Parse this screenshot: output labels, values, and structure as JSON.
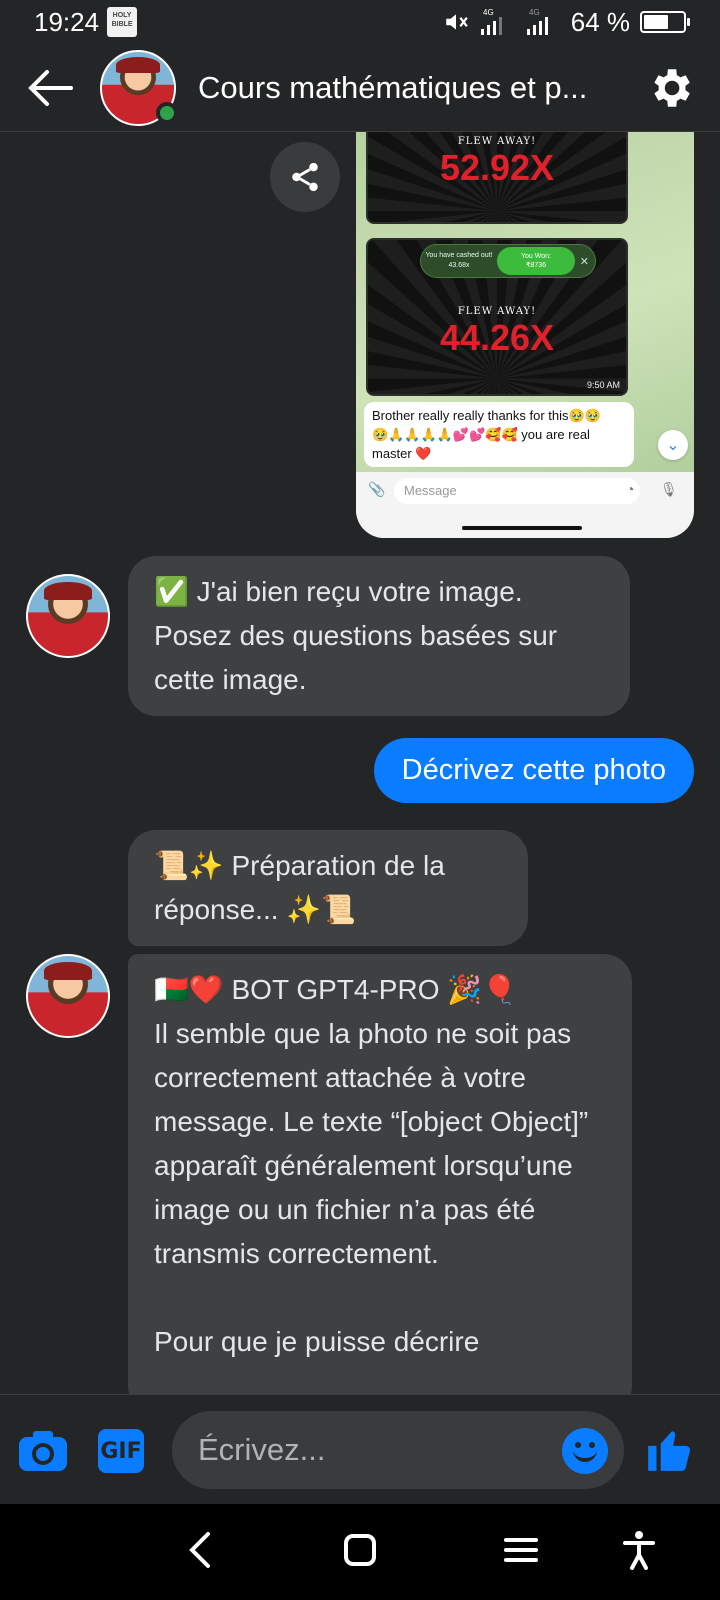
{
  "status": {
    "time": "19:24",
    "network1": "4G",
    "network2": "4G",
    "battery": "64 %",
    "battery_level": 0.64
  },
  "header": {
    "title": "Cours mathématiques et p..."
  },
  "screenshot": {
    "multiplier1": "52.92X",
    "flew_away": "FLEW AWAY!",
    "multiplier2": "44.26X",
    "cashout_left": "You have cashed out!",
    "cashout_left_value": "43.68x",
    "cashout_right": "You Won:",
    "cashout_right_value": "₹8736",
    "time": "9:50 AM",
    "message_line1": "Brother really really thanks for this🥹🥹",
    "message_line2": "🥹🙏🙏🙏🙏💕💕🥰🥰 you are real",
    "message_line3": "master ❤️",
    "input_placeholder": "Message"
  },
  "messages": {
    "m1": "✅ J'ai bien reçu votre image. Posez des questions basées sur cette image.",
    "m2": "Décrivez cette photo",
    "m3": "📜✨ Préparation de la réponse... ✨📜",
    "m4_line1": "🇲🇬❤️ BOT GPT4-PRO 🎉🎈",
    "m4_body": "Il semble que la photo ne soit pas correctement attachée à votre message. Le texte “[object Object]” apparaît généralement lorsqu’une image ou un fichier n’a pas été transmis correctement.",
    "m4_cut": "Pour que je puisse décrire"
  },
  "composer": {
    "placeholder": "Écrivez...",
    "gif_label": "GIF"
  },
  "colors": {
    "accent": "#0a7cff",
    "background": "#242526",
    "incoming_bubble": "#3e4042",
    "online": "#31a24c"
  }
}
